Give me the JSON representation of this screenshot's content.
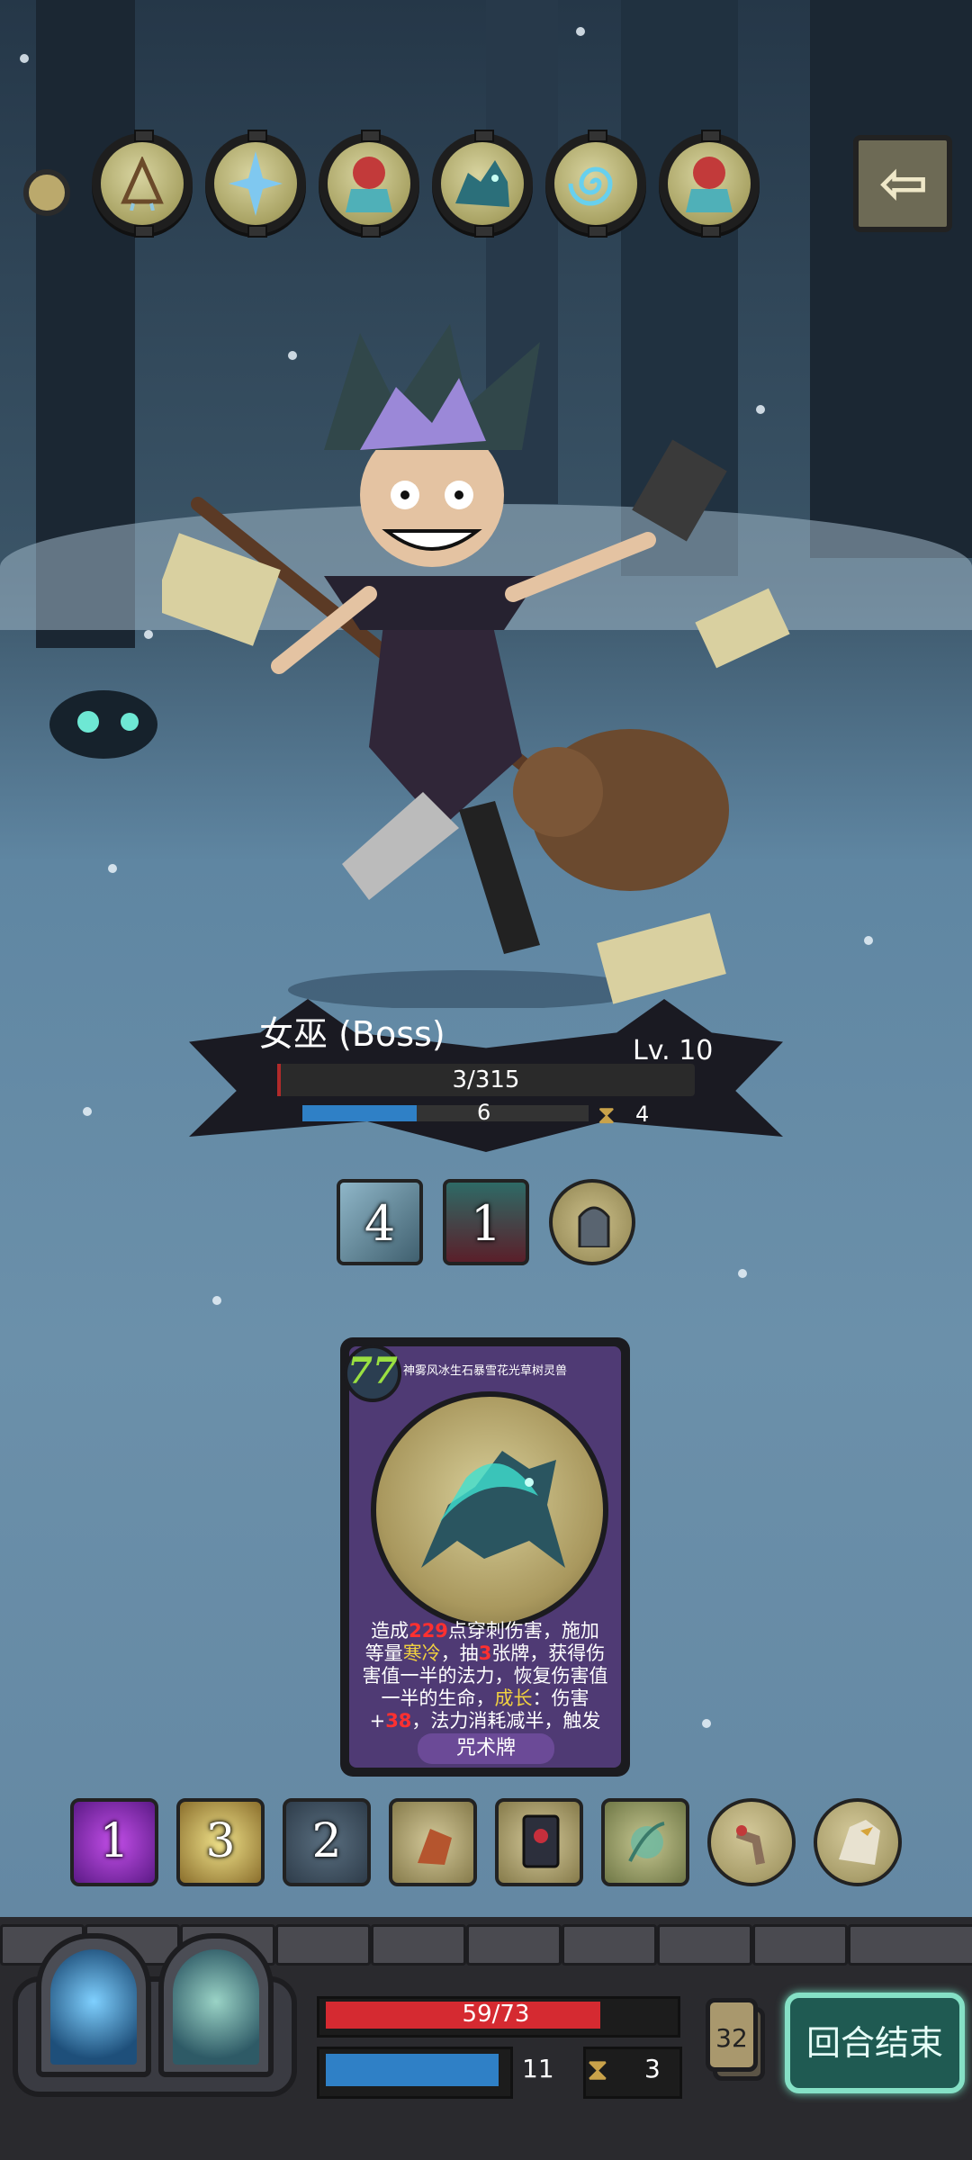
{
  "boss": {
    "name": "女巫 (Boss)",
    "level": "Lv. 10",
    "hp_text": "3/315",
    "hp_fraction": 0.0095,
    "mana_text": "6",
    "mana_fraction": 0.4,
    "hourglass_text": "4"
  },
  "boss_buffs": [
    {
      "icon": "frost-slash-icon",
      "count": "4"
    },
    {
      "icon": "cursed-chest-icon",
      "count": "1"
    },
    {
      "icon": "tombstone-icon",
      "count": ""
    }
  ],
  "relics": [
    "dreamcatcher-relic-icon",
    "ice-crystal-relic-icon",
    "red-hood-relic-icon",
    "spirit-wolf-relic-icon",
    "frost-spiral-relic-icon",
    "red-hood-relic-icon"
  ],
  "card": {
    "cost": "77",
    "name": "神雾风冰生石暴雪花光草树灵兽",
    "desc_parts": {
      "p1": "造成",
      "damage": "229",
      "p2": "点穿刺伤害，施加等量",
      "chill": "寒冷",
      "p3": "，抽",
      "draw": "3",
      "p4": "张牌，获得伤害值一半的法力，恢复伤害值一半的生命，",
      "growth": "成长",
      "p5": "：伤害+",
      "growth_value": "38",
      "p6": "，法力消耗减半，触发自"
    },
    "type": "咒术牌",
    "art_icon": "spectral-wolf-icon"
  },
  "items": [
    {
      "icon": "purple-eye-icon",
      "count": "1"
    },
    {
      "icon": "hooded-figure-icon",
      "count": "3"
    },
    {
      "icon": "orbit-planet-icon",
      "count": "2"
    },
    {
      "icon": "bird-warrior-icon",
      "count": ""
    },
    {
      "icon": "spellbook-icon",
      "count": ""
    },
    {
      "icon": "green-orb-icon",
      "count": ""
    },
    {
      "icon": "crane-figure-icon",
      "count": ""
    },
    {
      "icon": "eagle-icon",
      "count": ""
    }
  ],
  "player": {
    "hp_text": "59/73",
    "hp_fraction": 0.808,
    "mana_text": "11",
    "hourglass_text": "3",
    "deck_count": "32",
    "skills": [
      "blue-flame-hand-skill-icon",
      "boatman-mist-skill-icon"
    ]
  },
  "end_turn_label": "回合结束",
  "colors": {
    "enemy_hp": "#2a2a2a",
    "mana": "#2f80c6",
    "player_hp": "#d52a31",
    "card_cost": "#9ae041",
    "card_frame": "#4f3a74",
    "end_turn_border": "#85e1c6"
  }
}
